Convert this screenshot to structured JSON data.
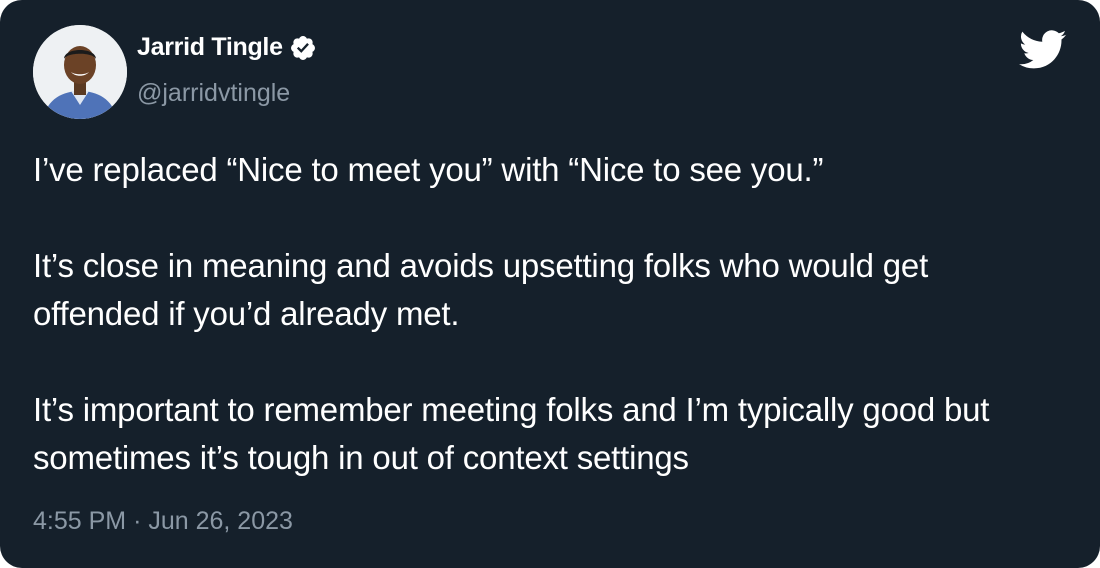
{
  "author": {
    "name": "Jarrid Tingle",
    "handle": "@jarridvtingle"
  },
  "icons": {
    "verified": "verified-badge-icon",
    "brand": "twitter-bird-icon",
    "avatar": "profile-photo"
  },
  "colors": {
    "background": "#15202b",
    "primary_text": "#ffffff",
    "secondary_text": "#8b98a5"
  },
  "tweet": {
    "paragraphs": [
      "I’ve replaced “Nice to meet you” with “Nice to see you.”",
      "It’s close in meaning and avoids upsetting folks who would get offended if you’d already met.",
      "It’s important to remember meeting folks and I’m typically good but sometimes it’s tough in out of context settings"
    ],
    "time": "4:55 PM",
    "separator": "·",
    "date": "Jun 26, 2023"
  }
}
